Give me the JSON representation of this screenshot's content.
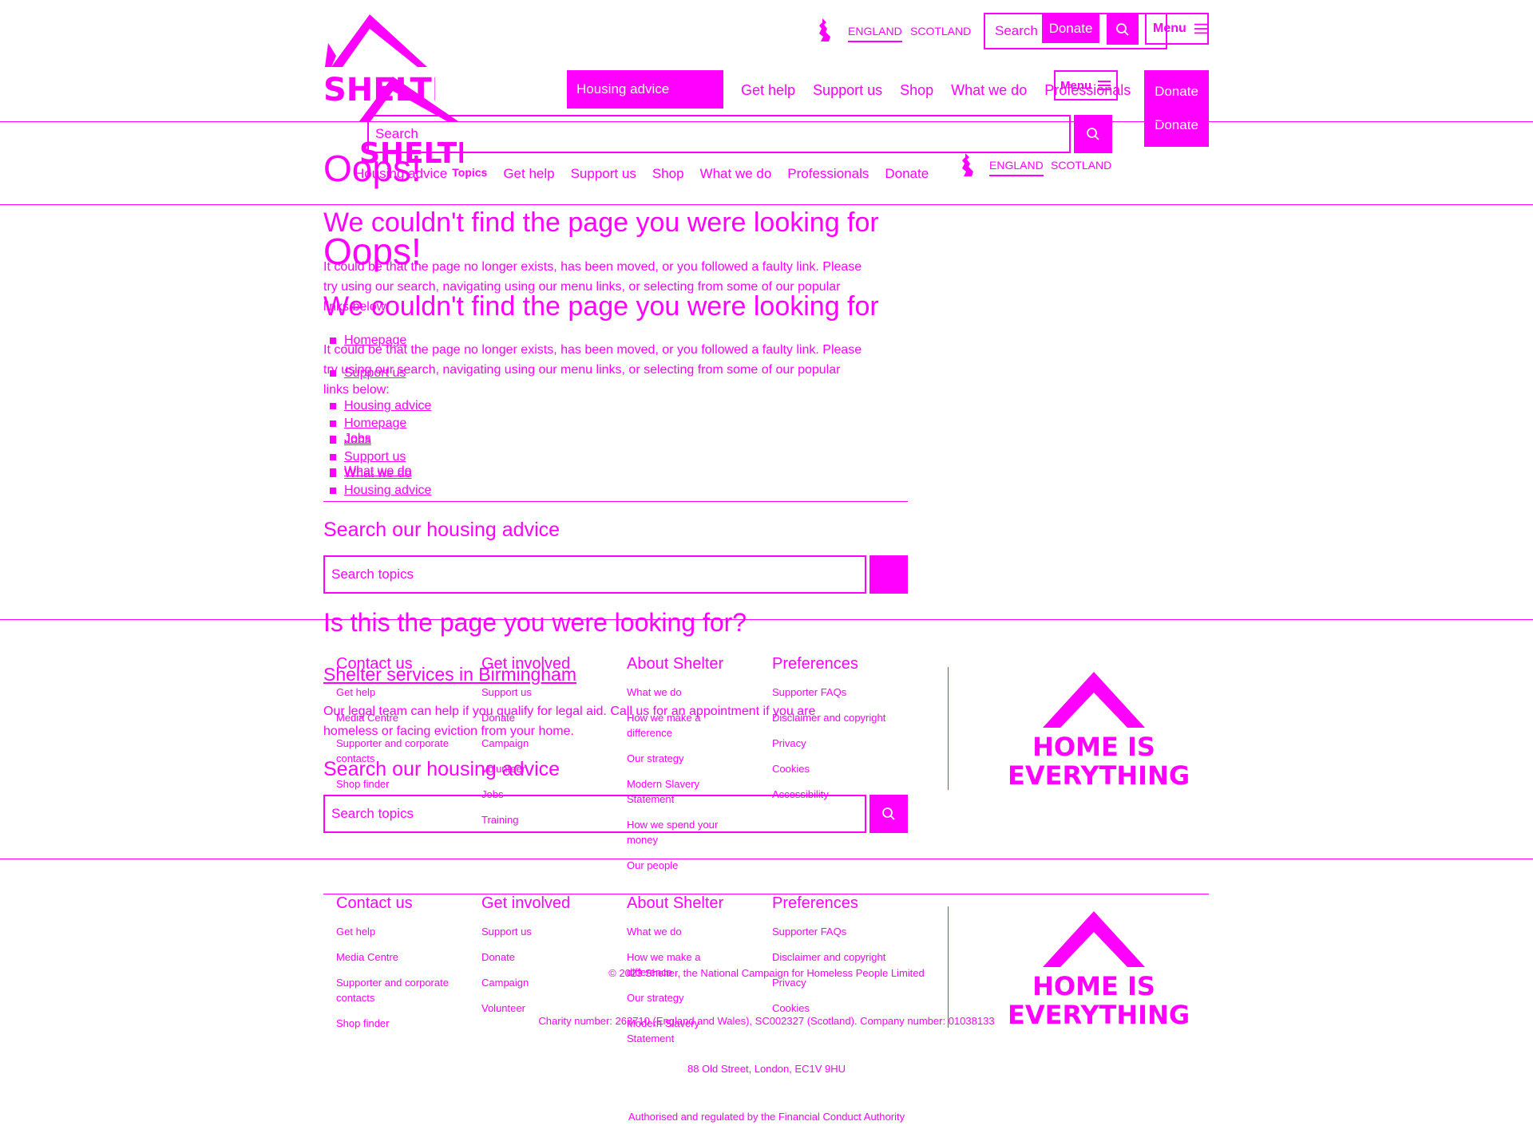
{
  "header": {
    "brand": "SHELTER",
    "regions": [
      "ENGLAND",
      "SCOTLAND"
    ],
    "search_label": "Search",
    "donate_label": "Donate",
    "menu_label": "Menu",
    "nav": {
      "housing_advice": "Housing advice",
      "items": [
        "Get help",
        "Support us",
        "Shop",
        "What we do",
        "Professionals"
      ],
      "secondary_items": [
        "Housing advice",
        "Topics",
        "Get help",
        "Support us",
        "Shop",
        "What we do",
        "Professionals",
        "Donate"
      ]
    },
    "search_placeholder": "Search"
  },
  "main": {
    "oops": "Oops!",
    "headline": "We couldn't find the page you were looking for",
    "intro_line1": "It could be that the page no longer exists, has been moved, or you followed a faulty link. Please",
    "intro_line2": "try using our search, navigating using our menu links, or selecting from some of our popular",
    "intro_line3": "links below:",
    "popular_links": [
      "Homepage",
      "Support us",
      "Housing advice",
      "Jobs",
      "What we do"
    ],
    "search_heading": "Search our housing advice",
    "search_placeholder": "Search topics",
    "question": "Is this the page you were looking for?",
    "result_title": "Shelter services in Birmingham",
    "result_desc_line1": "Our legal team can help if you qualify for legal aid. Call us for an appointment if you are",
    "result_desc_line2": "homeless or facing eviction from your home."
  },
  "footer": {
    "columns": [
      {
        "title": "Contact us",
        "items": [
          "Get help",
          "Media Centre",
          "Supporter and corporate contacts",
          "Shop finder"
        ]
      },
      {
        "title": "Get involved",
        "items": [
          "Support us",
          "Donate",
          "Campaign",
          "Volunteer",
          "Jobs",
          "Training"
        ]
      },
      {
        "title": "About Shelter",
        "items": [
          "What we do",
          "How we make a difference",
          "Our strategy",
          "Modern Slavery Statement",
          "How we spend your money",
          "Our people"
        ]
      },
      {
        "title": "Preferences",
        "items": [
          "Supporter FAQs",
          "Disclaimer and copyright",
          "Privacy",
          "Cookies",
          "Accessibility"
        ]
      }
    ],
    "tagline_line1": "HOME IS",
    "tagline_line2": "EVERYTHING",
    "copyright": [
      "© 2023 Shelter, the National Campaign for Homeless People Limited",
      "Charity number: 263710 (England and Wales), SC002327 (Scotland). Company number: 01038133",
      "88 Old Street, London, EC1V 9HU",
      "Authorised and regulated by the Financial Conduct Authority"
    ]
  },
  "colors": {
    "accent": "#ff00ff",
    "background": "#ffffff"
  },
  "icons": [
    "shelter-logo",
    "map-icon",
    "search-icon",
    "menu-icon",
    "home-roof-icon"
  ]
}
